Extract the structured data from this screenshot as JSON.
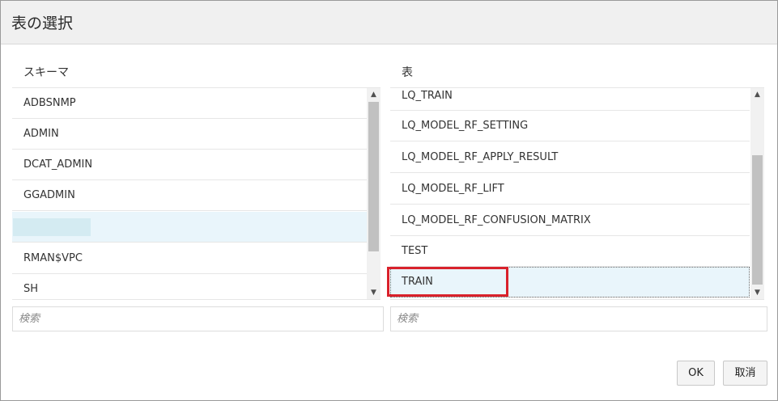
{
  "dialog": {
    "title": "表の選択"
  },
  "schema": {
    "header": "スキーマ",
    "items": [
      {
        "label": "ADBSNMP"
      },
      {
        "label": "ADMIN"
      },
      {
        "label": "DCAT_ADMIN"
      },
      {
        "label": "GGADMIN"
      },
      {
        "label": ""
      },
      {
        "label": "RMAN$VPC"
      },
      {
        "label": "SH"
      }
    ],
    "selected_index": 4,
    "search_placeholder": "検索",
    "scroll_position": 0.0
  },
  "tables": {
    "header": "表",
    "items": [
      {
        "label": "LQ_TRAIN"
      },
      {
        "label": "LQ_MODEL_RF_SETTING"
      },
      {
        "label": "LQ_MODEL_RF_APPLY_RESULT"
      },
      {
        "label": "LQ_MODEL_RF_LIFT"
      },
      {
        "label": "LQ_MODEL_RF_CONFUSION_MATRIX"
      },
      {
        "label": "TEST"
      },
      {
        "label": "TRAIN"
      }
    ],
    "selected_index": 6,
    "search_placeholder": "検索",
    "scroll_position": 1.0
  },
  "buttons": {
    "ok": "OK",
    "cancel": "取消"
  },
  "highlight_color": "#d9212b",
  "selection_color": "#e9f5fb"
}
